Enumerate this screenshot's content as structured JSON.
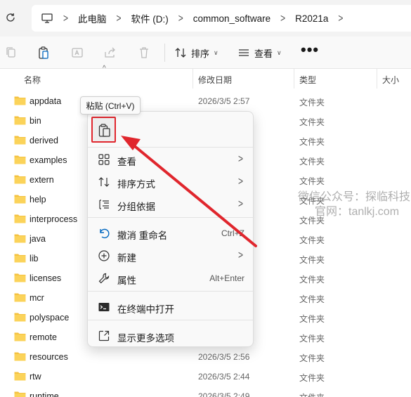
{
  "breadcrumb": {
    "segments": [
      "此电脑",
      "软件 (D:)",
      "common_software",
      "R2021a"
    ]
  },
  "toolbar": {
    "sort_label": "排序",
    "view_label": "查看",
    "more_label": "•••"
  },
  "columns": {
    "name": "名称",
    "date": "修改日期",
    "type": "类型",
    "size": "大小"
  },
  "files": [
    {
      "name": "appdata",
      "date": "2026/3/5 2:57",
      "type": "文件夹"
    },
    {
      "name": "bin",
      "date": "",
      "type": "文件夹"
    },
    {
      "name": "derived",
      "date": "",
      "type": "文件夹"
    },
    {
      "name": "examples",
      "date": "",
      "type": "文件夹"
    },
    {
      "name": "extern",
      "date": "",
      "type": "文件夹"
    },
    {
      "name": "help",
      "date": "",
      "type": "文件夹"
    },
    {
      "name": "interprocess",
      "date": "",
      "type": "文件夹"
    },
    {
      "name": "java",
      "date": "",
      "type": "文件夹"
    },
    {
      "name": "lib",
      "date": "",
      "type": "文件夹"
    },
    {
      "name": "licenses",
      "date": "",
      "type": "文件夹"
    },
    {
      "name": "mcr",
      "date": "",
      "type": "文件夹"
    },
    {
      "name": "polyspace",
      "date": "",
      "type": "文件夹"
    },
    {
      "name": "remote",
      "date": "",
      "type": "文件夹"
    },
    {
      "name": "resources",
      "date": "2026/3/5 2:56",
      "type": "文件夹"
    },
    {
      "name": "rtw",
      "date": "2026/3/5 2:44",
      "type": "文件夹"
    },
    {
      "name": "runtime",
      "date": "2026/3/5 2:49",
      "type": "文件夹"
    }
  ],
  "tooltip": "粘贴 (Ctrl+V)",
  "context_menu": {
    "view": "查看",
    "sort": "排序方式",
    "group": "分组依据",
    "undo": "撤消 重命名",
    "undo_shortcut": "Ctrl+Z",
    "new": "新建",
    "properties": "属性",
    "properties_shortcut": "Alt+Enter",
    "open_terminal": "在终端中打开",
    "more_options": "显示更多选项"
  },
  "watermark": {
    "line1": "微信公众号：探临科技",
    "line2": "官网：tanlkj.com"
  },
  "colors": {
    "folder": "#f4c240",
    "highlight": "#e0262d",
    "accent": "#0067c0"
  }
}
